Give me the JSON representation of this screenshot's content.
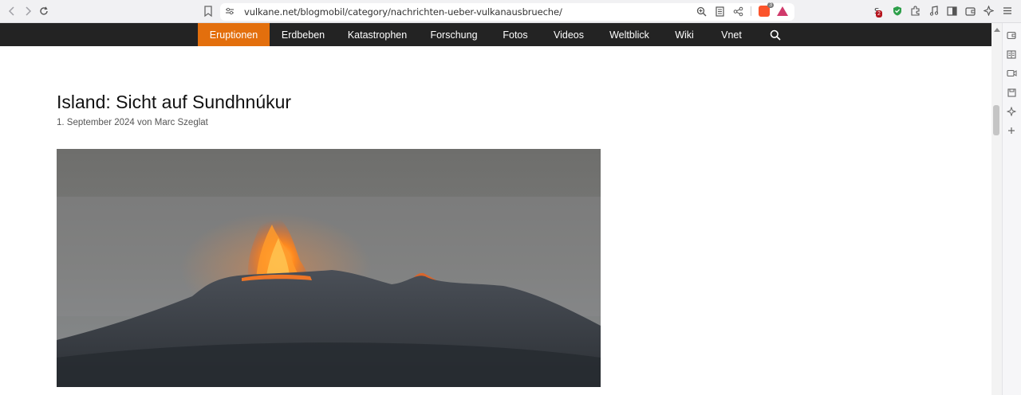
{
  "browser": {
    "url": "vulkane.net/blogmobil/category/nachrichten-ueber-vulkanausbrueche/",
    "shield_count": "3",
    "ext_badge": "2"
  },
  "site_nav": {
    "items": [
      {
        "label": "Eruptionen",
        "active": true
      },
      {
        "label": "Erdbeben"
      },
      {
        "label": "Katastrophen"
      },
      {
        "label": "Forschung"
      },
      {
        "label": "Fotos"
      },
      {
        "label": "Videos"
      },
      {
        "label": "Weltblick"
      },
      {
        "label": "Wiki"
      },
      {
        "label": "Vnet"
      }
    ],
    "active_color": "#e36f0d",
    "bar_color": "#232323"
  },
  "article": {
    "title": "Island: Sicht auf Sundhnúkur",
    "meta": "1. September 2024 von Marc Szeglat",
    "image_subject": "volcano-eruption-photo"
  }
}
